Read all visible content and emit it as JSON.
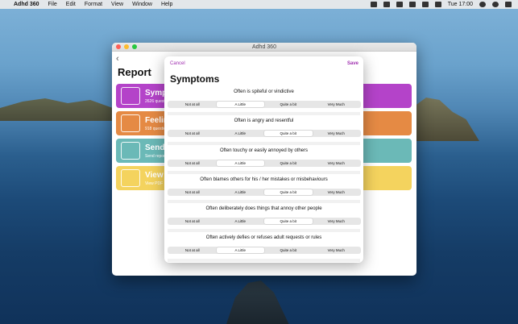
{
  "menubar": {
    "app_name": "Adhd 360",
    "items": [
      "File",
      "Edit",
      "Format",
      "View",
      "Window",
      "Help"
    ],
    "clock": "Tue 17:00"
  },
  "window": {
    "title": "Adhd 360",
    "report_title": "Report",
    "cards": [
      {
        "title": "Symp",
        "subtitle": "2626 questi",
        "color": "#b443c9",
        "icon": "people-icon"
      },
      {
        "title": "Feelin",
        "subtitle": "918 question",
        "color": "#e58a44",
        "icon": "head-icon"
      },
      {
        "title": "Send",
        "subtitle": "Send report",
        "color": "#6bb9b7",
        "icon": "share-icon"
      },
      {
        "title": "View",
        "subtitle": "View PDF",
        "color": "#f4d35e",
        "icon": "chart-icon"
      }
    ]
  },
  "modal": {
    "cancel_label": "Cancel",
    "save_label": "Save",
    "title": "Symptoms",
    "options": [
      "Not at all",
      "A Little",
      "Quite a bit",
      "Very Much"
    ],
    "questions": [
      {
        "text": "Often is spiteful or vindictive",
        "selected": 1
      },
      {
        "text": "Often is angry and resentful",
        "selected": 2
      },
      {
        "text": "Often touchy or easily annoyed by others",
        "selected": 1
      },
      {
        "text": "Often blames others for his / her mistakes or misbehaviours",
        "selected": 2
      },
      {
        "text": "Often deliberately does things that annoy other people",
        "selected": 2
      },
      {
        "text": "Often actively defies or refuses adult requests or rules",
        "selected": 1
      }
    ]
  }
}
